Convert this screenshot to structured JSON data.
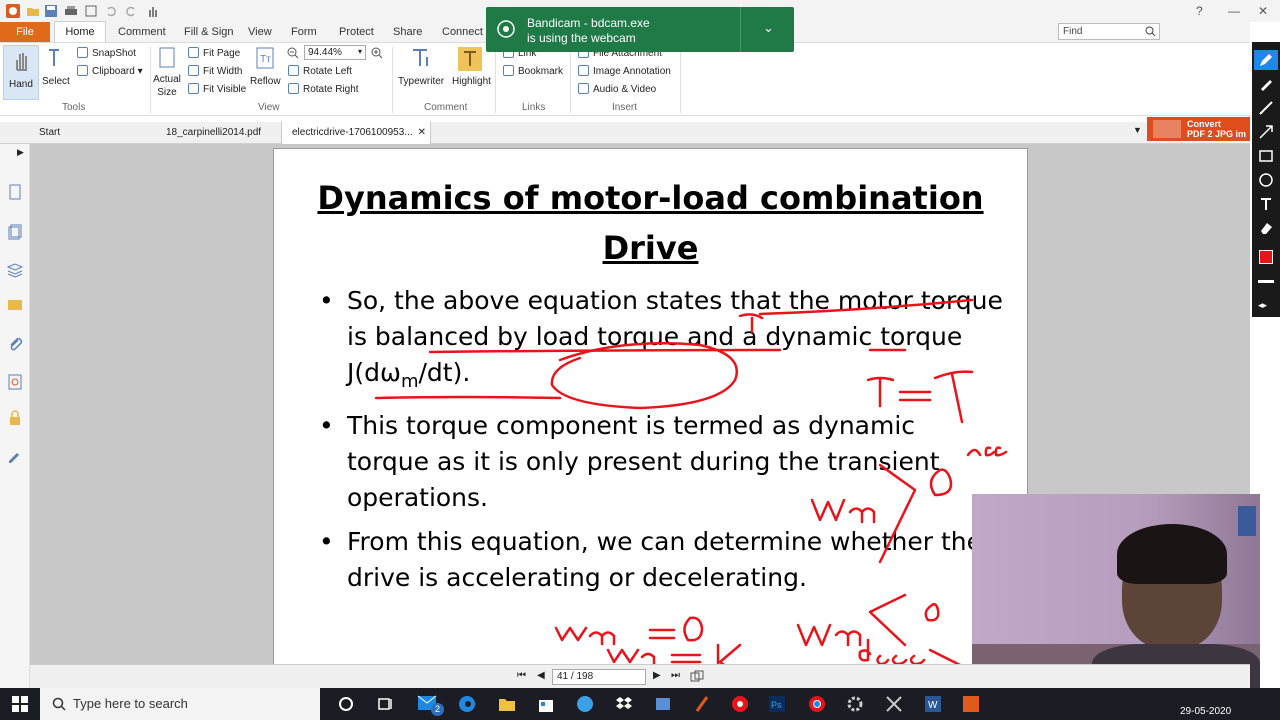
{
  "menu": {
    "file": "File",
    "tabs": [
      "Home",
      "Comment",
      "Fill & Sign",
      "View",
      "Form",
      "Protect",
      "Share",
      "Connect"
    ]
  },
  "search": {
    "placeholder": "Find"
  },
  "ribbon": {
    "hand": "Hand",
    "select": "Select",
    "snapshot": "SnapShot",
    "clipboard": "Clipboard",
    "actual_size": "Actual Size",
    "fit_page": "Fit Page",
    "fit_width": "Fit Width",
    "fit_visible": "Fit Visible",
    "reflow": "Reflow",
    "zoom": "94.44%",
    "rotate_left": "Rotate Left",
    "rotate_right": "Rotate Right",
    "typewriter": "Typewriter",
    "highlight": "Highlight",
    "link": "Link",
    "bookmark": "Bookmark",
    "file_attachment": "File Attachment",
    "image_annotation": "Image Annotation",
    "audio_video": "Audio & Video",
    "groups": [
      "Tools",
      "View",
      "Comment",
      "Links",
      "Insert"
    ]
  },
  "doc_tabs": [
    "Start",
    "18_carpinelli2014.pdf",
    "electricdrive-1706100953..."
  ],
  "convert_ad": {
    "line1": "Convert",
    "line2": "PDF 2 JPG im"
  },
  "slide": {
    "title": "Dynamics of motor-load combination Drive",
    "bullets": [
      "So, the above equation states that the motor torque is balanced by load torque and a dynamic torque J(dω",
      "This torque component is termed as dynamic torque as it is only present during the transient operations.",
      "From this equation, we can determine whether the drive is accelerating or decelerating."
    ],
    "bullet1_sub": "m",
    "bullet1_tail": "/dt)."
  },
  "annotations": {
    "ink_color": "#e8141a",
    "notes": [
      "T=T",
      "acc",
      "Wm > 0",
      "Wm = 0",
      "Wm = K",
      "Wm < 0",
      "decc"
    ]
  },
  "nav": {
    "page": "41 / 198"
  },
  "toast": {
    "title": "Bandicam - bdcam.exe",
    "message": "is using the webcam"
  },
  "taskbar": {
    "search": "Type here to search",
    "date": "29-05-2020",
    "mail_badge": "2"
  }
}
